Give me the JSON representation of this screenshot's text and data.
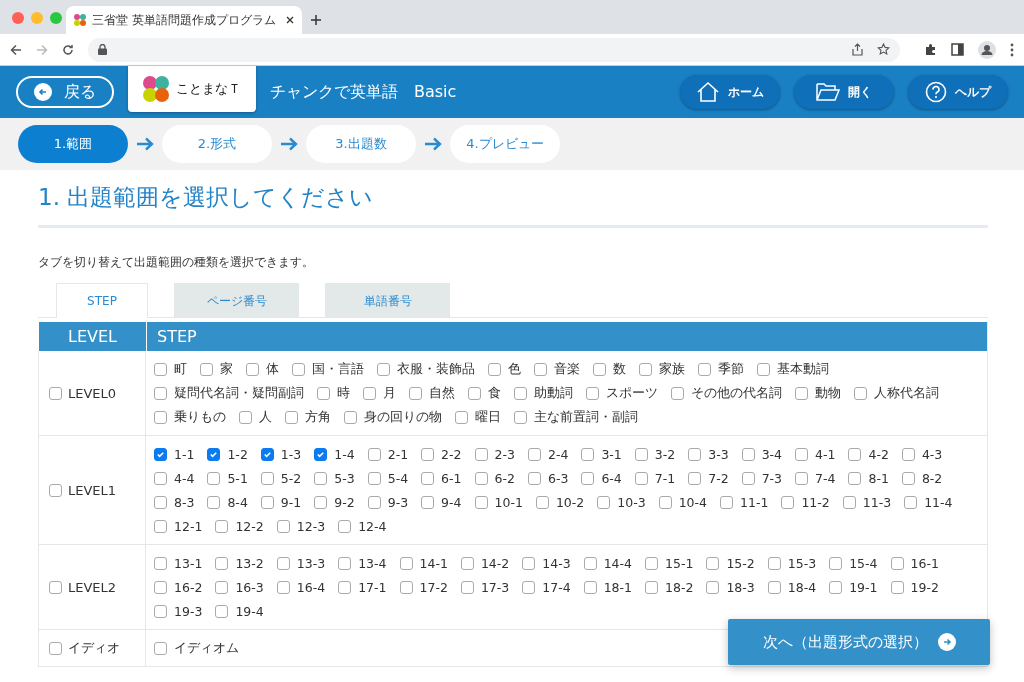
{
  "browser": {
    "tab_title": "三省堂 英単語問題作成プログラム"
  },
  "header": {
    "back": "戻る",
    "logo": "ことまなＴ",
    "title": "チャンクで英単語　Basic",
    "buttons": [
      {
        "kind": "home",
        "label": "ホーム"
      },
      {
        "kind": "open",
        "label": "開く"
      },
      {
        "kind": "help",
        "label": "ヘルプ"
      }
    ]
  },
  "steps": [
    {
      "label": "1.範囲",
      "selected": true
    },
    {
      "label": "2.形式",
      "selected": false
    },
    {
      "label": "3.出題数",
      "selected": false
    },
    {
      "label": "4.プレビュー",
      "selected": false
    }
  ],
  "heading": "1. 出題範囲を選択してください",
  "description": "タブを切り替えて出題範囲の種類を選択できます。",
  "tabs": [
    {
      "label": "STEP",
      "selected": true
    },
    {
      "label": "ページ番号",
      "selected": false
    },
    {
      "label": "単語番号",
      "selected": false
    }
  ],
  "table": {
    "columns": [
      "LEVEL",
      "STEP"
    ],
    "rows": [
      {
        "label": "LEVEL0",
        "checked": false,
        "items": [
          {
            "label": "町",
            "checked": false
          },
          {
            "label": "家",
            "checked": false
          },
          {
            "label": "体",
            "checked": false
          },
          {
            "label": "国・言語",
            "checked": false
          },
          {
            "label": "衣服・装飾品",
            "checked": false
          },
          {
            "label": "色",
            "checked": false
          },
          {
            "label": "音楽",
            "checked": false
          },
          {
            "label": "数",
            "checked": false
          },
          {
            "label": "家族",
            "checked": false
          },
          {
            "label": "季節",
            "checked": false
          },
          {
            "label": "基本動詞",
            "checked": false
          },
          {
            "label": "疑問代名詞・疑問副詞",
            "checked": false
          },
          {
            "label": "時",
            "checked": false
          },
          {
            "label": "月",
            "checked": false
          },
          {
            "label": "自然",
            "checked": false
          },
          {
            "label": "食",
            "checked": false
          },
          {
            "label": "助動詞",
            "checked": false
          },
          {
            "label": "スポーツ",
            "checked": false
          },
          {
            "label": "その他の代名詞",
            "checked": false
          },
          {
            "label": "動物",
            "checked": false
          },
          {
            "label": "人称代名詞",
            "checked": false
          },
          {
            "label": "乗りもの",
            "checked": false
          },
          {
            "label": "人",
            "checked": false
          },
          {
            "label": "方角",
            "checked": false
          },
          {
            "label": "身の回りの物",
            "checked": false
          },
          {
            "label": "曜日",
            "checked": false
          },
          {
            "label": "主な前置詞・副詞",
            "checked": false
          }
        ]
      },
      {
        "label": "LEVEL1",
        "checked": false,
        "items": [
          {
            "label": "1-1",
            "checked": true
          },
          {
            "label": "1-2",
            "checked": true
          },
          {
            "label": "1-3",
            "checked": true
          },
          {
            "label": "1-4",
            "checked": true
          },
          {
            "label": "2-1",
            "checked": false
          },
          {
            "label": "2-2",
            "checked": false
          },
          {
            "label": "2-3",
            "checked": false
          },
          {
            "label": "2-4",
            "checked": false
          },
          {
            "label": "3-1",
            "checked": false
          },
          {
            "label": "3-2",
            "checked": false
          },
          {
            "label": "3-3",
            "checked": false
          },
          {
            "label": "3-4",
            "checked": false
          },
          {
            "label": "4-1",
            "checked": false
          },
          {
            "label": "4-2",
            "checked": false
          },
          {
            "label": "4-3",
            "checked": false
          },
          {
            "label": "4-4",
            "checked": false
          },
          {
            "label": "5-1",
            "checked": false
          },
          {
            "label": "5-2",
            "checked": false
          },
          {
            "label": "5-3",
            "checked": false
          },
          {
            "label": "5-4",
            "checked": false
          },
          {
            "label": "6-1",
            "checked": false
          },
          {
            "label": "6-2",
            "checked": false
          },
          {
            "label": "6-3",
            "checked": false
          },
          {
            "label": "6-4",
            "checked": false
          },
          {
            "label": "7-1",
            "checked": false
          },
          {
            "label": "7-2",
            "checked": false
          },
          {
            "label": "7-3",
            "checked": false
          },
          {
            "label": "7-4",
            "checked": false
          },
          {
            "label": "8-1",
            "checked": false
          },
          {
            "label": "8-2",
            "checked": false
          },
          {
            "label": "8-3",
            "checked": false
          },
          {
            "label": "8-4",
            "checked": false
          },
          {
            "label": "9-1",
            "checked": false
          },
          {
            "label": "9-2",
            "checked": false
          },
          {
            "label": "9-3",
            "checked": false
          },
          {
            "label": "9-4",
            "checked": false
          },
          {
            "label": "10-1",
            "checked": false
          },
          {
            "label": "10-2",
            "checked": false
          },
          {
            "label": "10-3",
            "checked": false
          },
          {
            "label": "10-4",
            "checked": false
          },
          {
            "label": "11-1",
            "checked": false
          },
          {
            "label": "11-2",
            "checked": false
          },
          {
            "label": "11-3",
            "checked": false
          },
          {
            "label": "11-4",
            "checked": false
          },
          {
            "label": "12-1",
            "checked": false
          },
          {
            "label": "12-2",
            "checked": false
          },
          {
            "label": "12-3",
            "checked": false
          },
          {
            "label": "12-4",
            "checked": false
          }
        ]
      },
      {
        "label": "LEVEL2",
        "checked": false,
        "items": [
          {
            "label": "13-1",
            "checked": false
          },
          {
            "label": "13-2",
            "checked": false
          },
          {
            "label": "13-3",
            "checked": false
          },
          {
            "label": "13-4",
            "checked": false
          },
          {
            "label": "14-1",
            "checked": false
          },
          {
            "label": "14-2",
            "checked": false
          },
          {
            "label": "14-3",
            "checked": false
          },
          {
            "label": "14-4",
            "checked": false
          },
          {
            "label": "15-1",
            "checked": false
          },
          {
            "label": "15-2",
            "checked": false
          },
          {
            "label": "15-3",
            "checked": false
          },
          {
            "label": "15-4",
            "checked": false
          },
          {
            "label": "16-1",
            "checked": false
          },
          {
            "label": "16-2",
            "checked": false
          },
          {
            "label": "16-3",
            "checked": false
          },
          {
            "label": "16-4",
            "checked": false
          },
          {
            "label": "17-1",
            "checked": false
          },
          {
            "label": "17-2",
            "checked": false
          },
          {
            "label": "17-3",
            "checked": false
          },
          {
            "label": "17-4",
            "checked": false
          },
          {
            "label": "18-1",
            "checked": false
          },
          {
            "label": "18-2",
            "checked": false
          },
          {
            "label": "18-3",
            "checked": false
          },
          {
            "label": "18-4",
            "checked": false
          },
          {
            "label": "19-1",
            "checked": false
          },
          {
            "label": "19-2",
            "checked": false
          },
          {
            "label": "19-3",
            "checked": false
          },
          {
            "label": "19-4",
            "checked": false
          }
        ]
      },
      {
        "label": "イディオ",
        "checked": false,
        "items": [
          {
            "label": "イディオム",
            "checked": false
          }
        ]
      }
    ]
  },
  "next_button": "次へ（出題形式の選択）"
}
